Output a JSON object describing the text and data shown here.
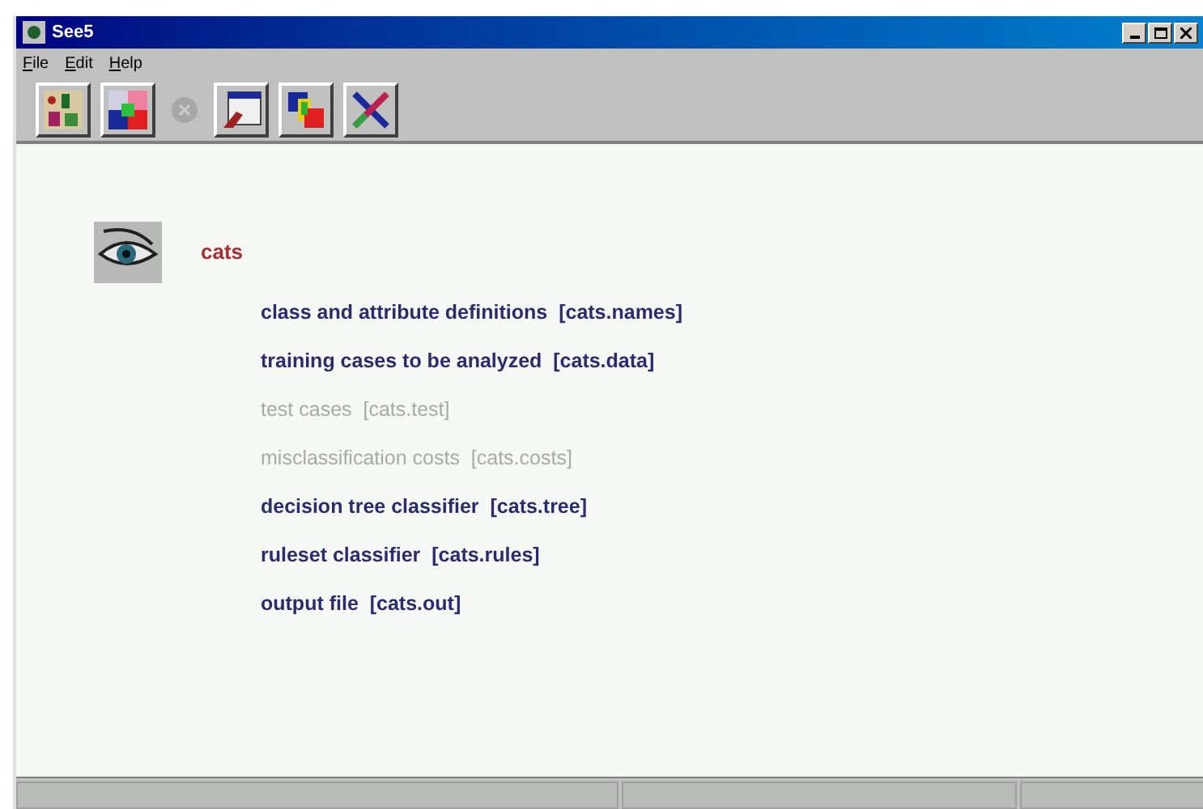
{
  "window": {
    "title": "See5"
  },
  "menu": [
    "File",
    "Edit",
    "Help"
  ],
  "toolbar": [
    {
      "kind": "locate",
      "disabled": false
    },
    {
      "kind": "construct",
      "disabled": false
    },
    {
      "kind": "stop",
      "disabled": true
    },
    {
      "kind": "review",
      "disabled": false
    },
    {
      "kind": "crossref",
      "disabled": false
    },
    {
      "kind": "cross",
      "disabled": false
    }
  ],
  "application": {
    "name": "cats"
  },
  "files": [
    {
      "label": "class and attribute definitions",
      "file": "[cats.names]",
      "disabled": false
    },
    {
      "label": "training cases to be analyzed",
      "file": "[cats.data]",
      "disabled": false
    },
    {
      "label": "test cases",
      "file": "[cats.test]",
      "disabled": true
    },
    {
      "label": "misclassification costs",
      "file": "[cats.costs]",
      "disabled": true
    },
    {
      "label": "decision tree classifier",
      "file": "[cats.tree]",
      "disabled": false
    },
    {
      "label": "ruleset classifier",
      "file": "[cats.rules]",
      "disabled": false
    },
    {
      "label": "output file",
      "file": "[cats.out]",
      "disabled": false
    }
  ]
}
